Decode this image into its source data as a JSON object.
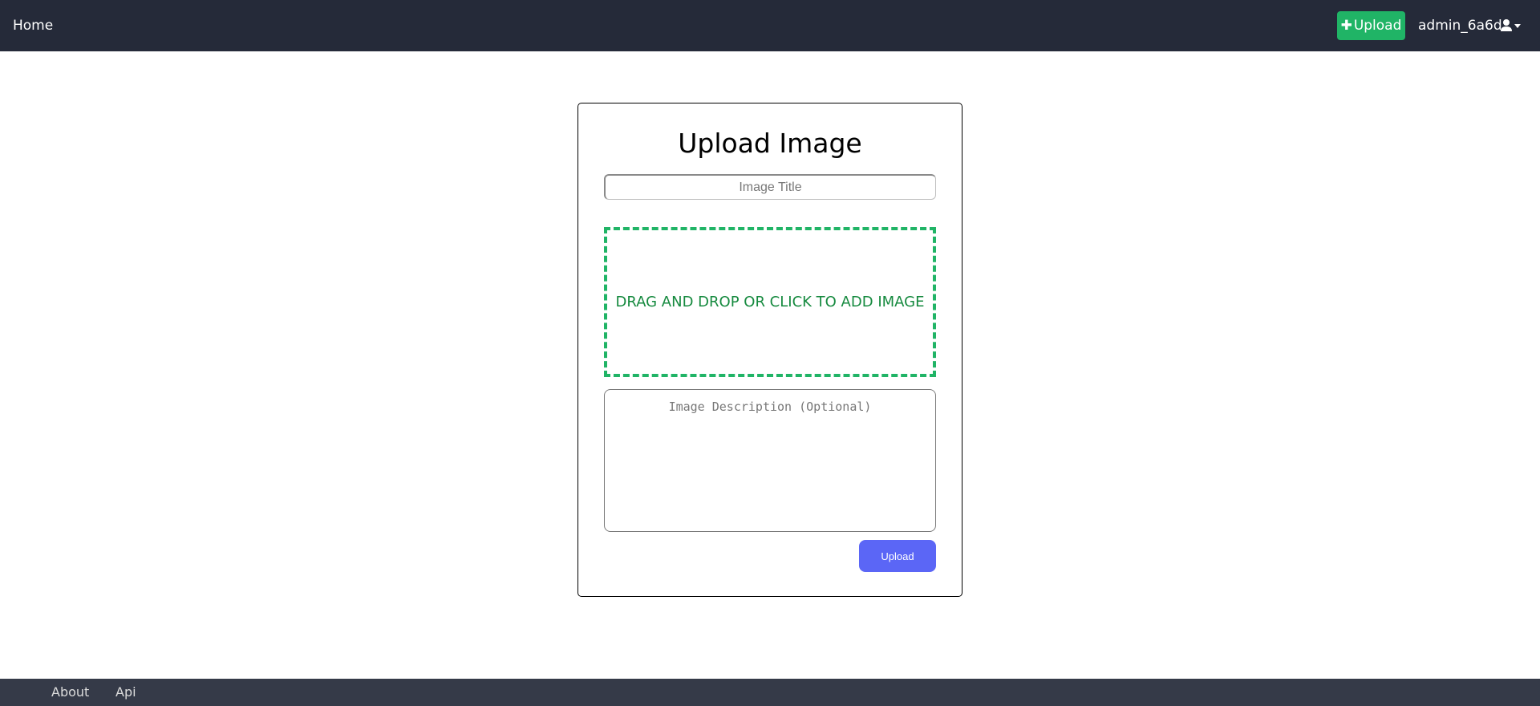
{
  "navbar": {
    "home_label": "Home",
    "upload_label": "Upload",
    "upload_icon": "plus-icon",
    "username": "admin_6a6d",
    "user_icon": "user-icon",
    "menu_icon": "caret-down-icon",
    "background": "#252a39",
    "accent": "#20b466"
  },
  "upload_form": {
    "title": "Upload Image",
    "title_placeholder": "Image Title",
    "title_value": "",
    "dropzone_text": "DRAG AND DROP OR CLICK TO ADD IMAGE",
    "description_placeholder": "Image Description (Optional)",
    "description_value": "",
    "submit_label": "Upload",
    "submit_color": "#5b66f6",
    "dropzone_color": "#20b466"
  },
  "footer": {
    "links": [
      {
        "label": "About"
      },
      {
        "label": "Api"
      }
    ],
    "background": "#353a48"
  }
}
